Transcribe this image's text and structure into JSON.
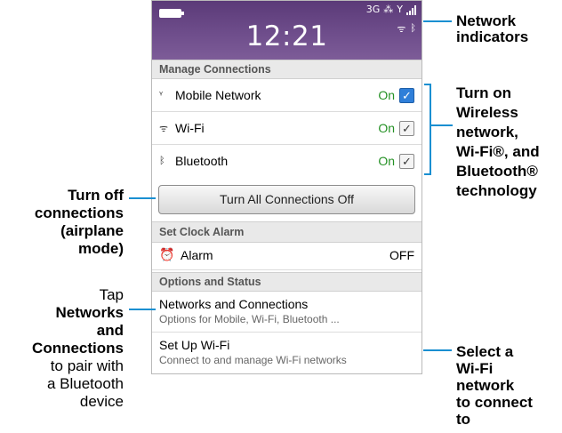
{
  "phone": {
    "status": {
      "time": "12:21",
      "network_type": "3G",
      "bb_glyph": "⁂",
      "icons": [
        "battery-icon",
        "signal-bars-icon",
        "wifi-icon",
        "bluetooth-icon"
      ]
    },
    "manage_connections": {
      "header": "Manage Connections",
      "rows": [
        {
          "icon": "mobile-network-icon",
          "label": "Mobile Network",
          "state": "On",
          "checked": true
        },
        {
          "icon": "wifi-icon",
          "label": "Wi-Fi",
          "state": "On",
          "checked": true
        },
        {
          "icon": "bluetooth-icon",
          "label": "Bluetooth",
          "state": "On",
          "checked": true
        }
      ],
      "all_off_button": "Turn All Connections Off"
    },
    "clock_alarm": {
      "header": "Set Clock Alarm",
      "alarm_label": "Alarm",
      "alarm_state": "OFF"
    },
    "options": {
      "header": "Options and Status",
      "items": [
        {
          "title": "Networks and Connections",
          "subtitle": "Options for Mobile, Wi-Fi, Bluetooth ..."
        },
        {
          "title": "Set Up Wi-Fi",
          "subtitle": "Connect to and manage Wi-Fi networks"
        }
      ]
    }
  },
  "annotations": {
    "network_indicators": [
      "Network",
      "indicators"
    ],
    "turn_on": [
      "Turn on",
      "Wireless",
      "network,",
      "Wi-Fi®, and",
      "Bluetooth®",
      "technology"
    ],
    "turn_off": [
      "Turn off",
      "connections",
      "(airplane",
      "mode)"
    ],
    "tap": [
      "Tap",
      "Networks",
      "and",
      "Connections",
      "to pair with",
      "a Bluetooth",
      "device"
    ],
    "select": [
      "Select a",
      "Wi-Fi",
      "network",
      "to connect",
      "to"
    ]
  },
  "colors": {
    "status_bar": "#6e4d8b",
    "on_state": "#259125",
    "checkbox_blue": "#2f7fd9",
    "callout_line": "#1a8fd1"
  }
}
